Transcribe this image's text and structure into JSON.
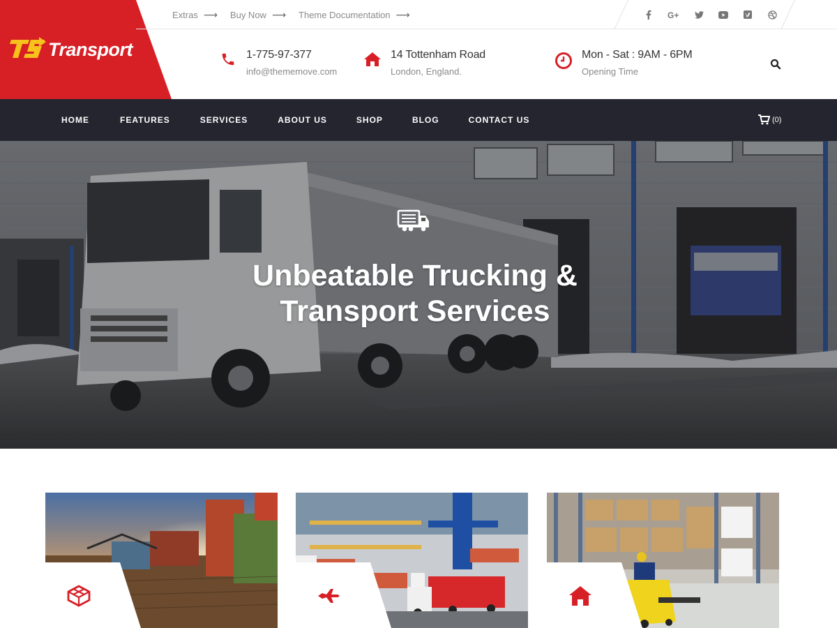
{
  "brand": {
    "name": "Transport",
    "logo_mark": "TS",
    "accent": "#d71f26"
  },
  "topbar": {
    "links": [
      {
        "label": "Extras",
        "icon": "arrow-right-icon"
      },
      {
        "label": "Buy Now",
        "icon": "arrow-right-icon"
      },
      {
        "label": "Theme Documentation",
        "icon": "arrow-right-icon"
      }
    ],
    "socials": [
      "facebook-icon",
      "google-plus-icon",
      "twitter-icon",
      "youtube-icon",
      "vimeo-icon",
      "dribbble-icon"
    ]
  },
  "header": {
    "phone": {
      "main": "1-775-97-377",
      "sub": "info@thememove.com",
      "icon": "phone-icon"
    },
    "address": {
      "main": "14 Tottenham Road",
      "sub": "London, England.",
      "icon": "home-icon"
    },
    "hours": {
      "main": "Mon - Sat : 9AM - 6PM",
      "sub": "Opening Time",
      "icon": "clock-icon"
    },
    "search_icon": "search-icon"
  },
  "nav": {
    "items": [
      "HOME",
      "FEATURES",
      "SERVICES",
      "ABOUT US",
      "SHOP",
      "BLOG",
      "CONTACT US"
    ],
    "cart_count": "(0)"
  },
  "hero": {
    "icon": "truck-icon",
    "title_line1": "Unbeatable Trucking &",
    "title_line2": "Transport Services"
  },
  "cards": [
    {
      "icon": "cube-icon",
      "image": "container-yard-photo"
    },
    {
      "icon": "plane-icon",
      "image": "port-trucks-photo"
    },
    {
      "icon": "home-icon",
      "image": "warehouse-forklift-photo"
    }
  ]
}
